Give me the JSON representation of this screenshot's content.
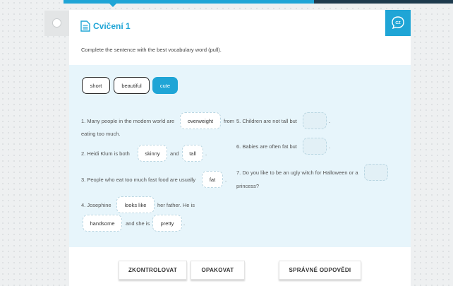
{
  "header": {
    "title": "Cvičení 1",
    "lang": "CZ"
  },
  "instruction": "Complete the sentence with the best vocabulary word (pull).",
  "word_bank": [
    {
      "label": "short",
      "active": false
    },
    {
      "label": "beautiful",
      "active": false
    },
    {
      "label": "cute",
      "active": true
    }
  ],
  "sentences": {
    "s1": {
      "before": "1.  Many people in the modern world are",
      "blank": "overweight",
      "after": "from",
      "cont": "eating too much."
    },
    "s2": {
      "before": "2.  Heidi Klum is both",
      "blank1": "skinny",
      "mid": "and",
      "blank2": "tall",
      "after": "."
    },
    "s3": {
      "before": "3.  People who eat too much fast food are usually",
      "blank": "fat",
      "after": "."
    },
    "s4": {
      "before": "4.  Josephine",
      "blank1": "looks like",
      "mid": "her father. He is",
      "blank2": "handsome",
      "mid2": "and she is",
      "blank3": "pretty",
      "after": "."
    },
    "s5": {
      "before": "5.  Children are not tall but",
      "blank": "",
      "after": "."
    },
    "s6": {
      "before": "6.  Babies are often fat but",
      "blank": "",
      "after": "."
    },
    "s7": {
      "before": "7.  Do you like to be an ugly witch for Halloween or a",
      "blank": "",
      "cont": "princess?"
    }
  },
  "buttons": {
    "check": "ZKONTROLOVAT",
    "repeat": "OPAKOVAT",
    "answers": "SPRÁVNÉ ODPOVĚDI"
  },
  "colors": {
    "accent": "#1fa5d6",
    "dark": "#1d3a4d",
    "exercise_bg": "#e7f5fb"
  }
}
